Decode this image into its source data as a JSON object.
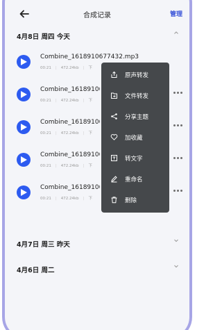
{
  "header": {
    "title": "合成记录",
    "manage_label": "管理"
  },
  "groups": [
    {
      "title": "4月8日 周四 今天"
    },
    {
      "title": "4月7日 周三 昨天"
    },
    {
      "title": "4月6日 周二"
    }
  ],
  "records": [
    {
      "name": "Combine_1618910677432.mp3",
      "time": "00:21",
      "size": "472.24kb",
      "extra": "下"
    },
    {
      "name": "Combine_16189106",
      "time": "00:21",
      "size": "472.24kb",
      "extra": "下"
    },
    {
      "name": "Combine_16189106",
      "time": "00:21",
      "size": "472.24kb",
      "extra": "下"
    },
    {
      "name": "Combine_16189106",
      "time": "00:21",
      "size": "472.24kb",
      "extra": "下"
    },
    {
      "name": "Combine_16189106",
      "time": "00:21",
      "size": "472.24kb",
      "extra": "下"
    }
  ],
  "menu": {
    "items": [
      {
        "label": "原声转发",
        "icon": "share-out-icon"
      },
      {
        "label": "文件转发",
        "icon": "file-forward-icon"
      },
      {
        "label": "分享主题",
        "icon": "share-nodes-icon"
      },
      {
        "label": "加收藏",
        "icon": "heart-icon"
      },
      {
        "label": "转文字",
        "icon": "text-convert-icon"
      },
      {
        "label": "重命名",
        "icon": "pencil-icon"
      },
      {
        "label": "删除",
        "icon": "trash-icon"
      }
    ]
  },
  "colors": {
    "accent": "#2d5bf0",
    "frame": "#a7a5e6",
    "menu_bg": "#45484b"
  }
}
